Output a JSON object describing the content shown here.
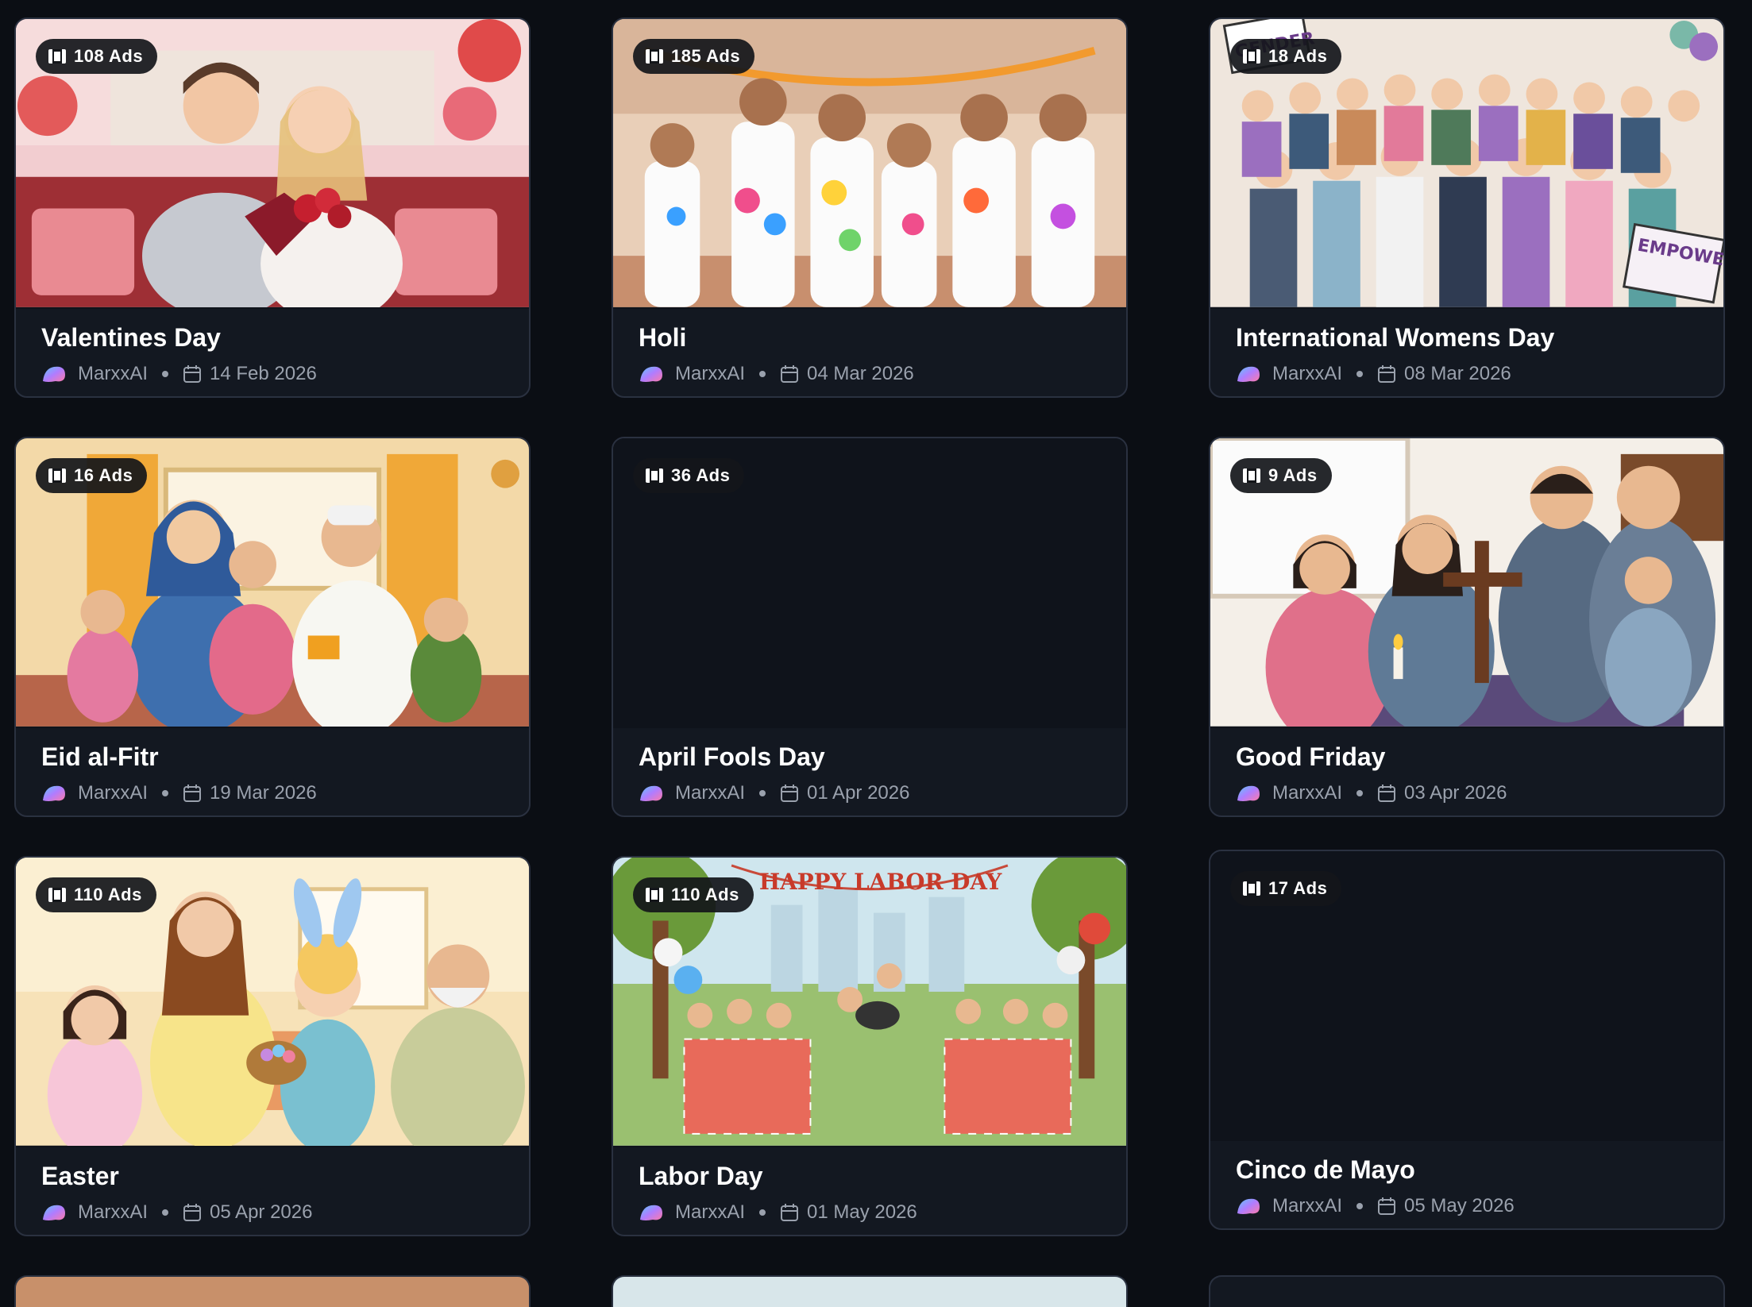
{
  "cards": [
    {
      "title": "Valentines Day",
      "ads": "108 Ads",
      "author": "MarxxAI",
      "date": "14 Feb 2026",
      "has_image": true,
      "image_subject": "couple with roses and heart chocolates on red sofa"
    },
    {
      "title": "Holi",
      "ads": "185 Ads",
      "author": "MarxxAI",
      "date": "04 Mar 2026",
      "has_image": true,
      "image_subject": "group celebrating with colored powder"
    },
    {
      "title": "International Womens Day",
      "ads": "18 Ads",
      "author": "MarxxAI",
      "date": "08 Mar 2026",
      "has_image": true,
      "image_subject": "crowd of women with signs"
    },
    {
      "title": "Eid al-Fitr",
      "ads": "16 Ads",
      "author": "MarxxAI",
      "date": "19 Mar 2026",
      "has_image": true,
      "image_subject": "family celebrating at home"
    },
    {
      "title": "April Fools Day",
      "ads": "36 Ads",
      "author": "MarxxAI",
      "date": "01 Apr 2026",
      "has_image": false,
      "image_subject": ""
    },
    {
      "title": "Good Friday",
      "ads": "9 Ads",
      "author": "MarxxAI",
      "date": "03 Apr 2026",
      "has_image": true,
      "image_subject": "family praying at table with cross and candle"
    },
    {
      "title": "Easter",
      "ads": "110 Ads",
      "author": "MarxxAI",
      "date": "05 Apr 2026",
      "has_image": true,
      "image_subject": "family with bunny ears and egg basket"
    },
    {
      "title": "Labor Day",
      "ads": "110 Ads",
      "author": "MarxxAI",
      "date": "01 May 2026",
      "has_image": true,
      "image_subject": "park picnic with banner"
    },
    {
      "title": "Cinco de Mayo",
      "ads": "17 Ads",
      "author": "MarxxAI",
      "date": "05 May 2026",
      "has_image": false,
      "image_subject": ""
    }
  ],
  "scene_images": {
    "0": {
      "label": "",
      "sign": ""
    },
    "2": {
      "label": "",
      "sign": "EMPOWER HER",
      "sign2": "GENDER"
    },
    "7": {
      "label": "",
      "sign": "HAPPY LABOR DAY"
    }
  },
  "colors": {
    "page_bg": "#0b0e14",
    "card_bg": "#131821",
    "card_border": "#2a3140",
    "muted_text": "#9aa1ad",
    "badge_bg": "#14161a"
  },
  "icons": {
    "badge": "film-strip-icon",
    "author": "marxx-logo-icon",
    "date": "calendar-icon"
  }
}
